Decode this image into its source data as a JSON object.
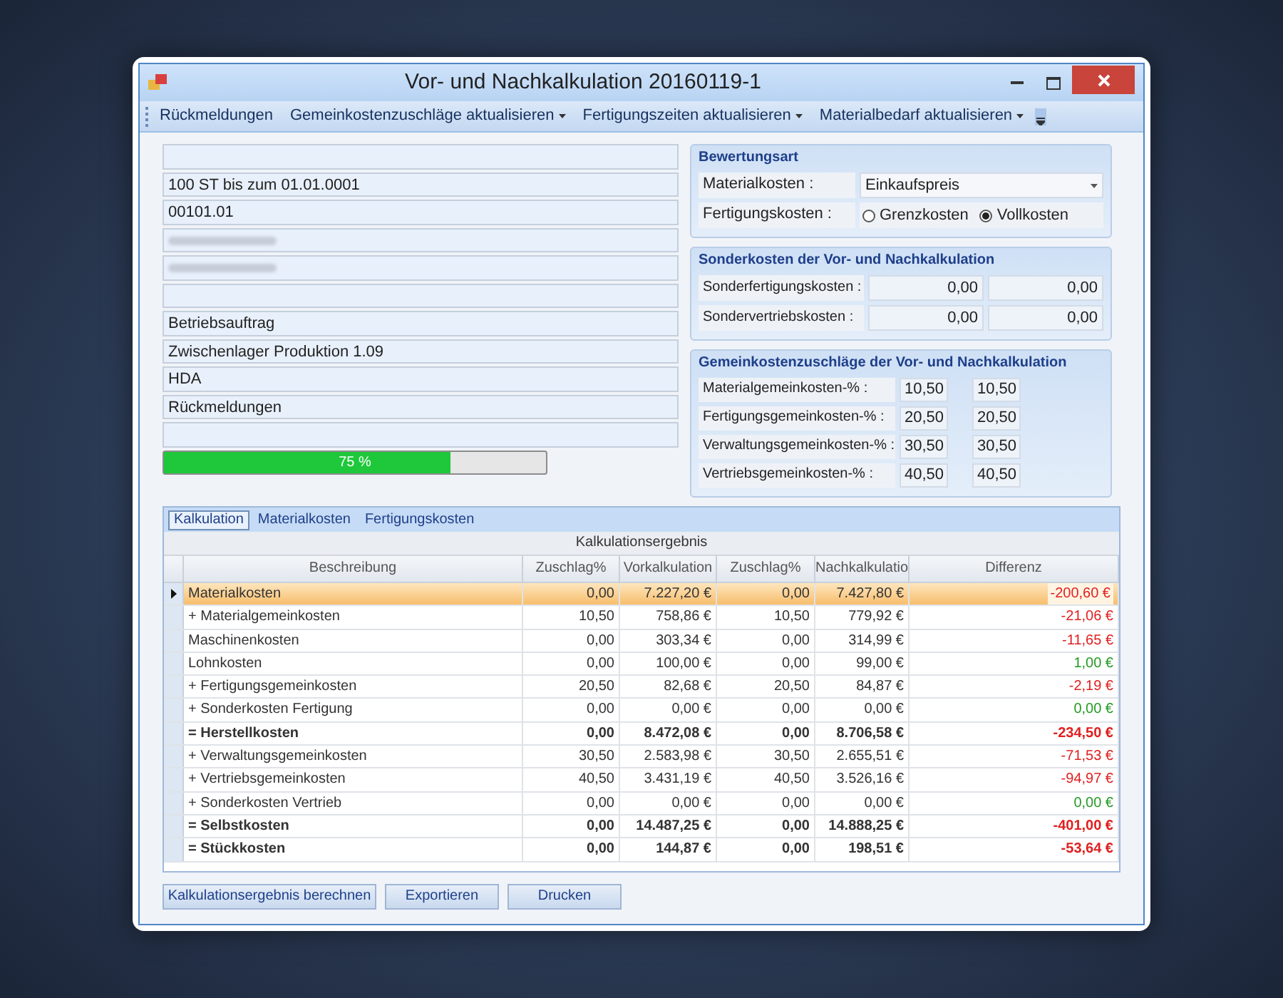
{
  "window": {
    "title": "Vor- und Nachkalkulation 20160119-1"
  },
  "toolbar": {
    "items": [
      {
        "label": "Rückmeldungen",
        "dropdown": false
      },
      {
        "label": "Gemeinkostenzuschläge aktualisieren",
        "dropdown": true
      },
      {
        "label": "Fertigungszeiten aktualisieren",
        "dropdown": true
      },
      {
        "label": "Materialbedarf aktualisieren",
        "dropdown": true
      }
    ]
  },
  "info_fields": [
    {
      "kind": "empty"
    },
    {
      "kind": "text",
      "value": "100 ST bis zum 01.01.0001"
    },
    {
      "kind": "text",
      "value": "00101.01"
    },
    {
      "kind": "blurred"
    },
    {
      "kind": "blurred"
    },
    {
      "kind": "empty"
    },
    {
      "kind": "text",
      "value": "Betriebsauftrag"
    },
    {
      "kind": "text",
      "value": "Zwischenlager Produktion 1.09"
    },
    {
      "kind": "text",
      "value": "HDA"
    },
    {
      "kind": "text",
      "value": "Rückmeldungen"
    },
    {
      "kind": "empty"
    }
  ],
  "progress": {
    "level": 0.75,
    "label": "75 %"
  },
  "bewertungsart": {
    "title": "Bewertungsart",
    "material_label": "Materialkosten :",
    "material_value": "Einkaufspreis",
    "fertigung_label": "Fertigungskosten :",
    "options": [
      {
        "label": "Grenzkosten",
        "selected": false
      },
      {
        "label": "Vollkosten",
        "selected": true
      }
    ]
  },
  "sonderkosten": {
    "title": "Sonderkosten der Vor- und Nachkalkulation",
    "rows": [
      {
        "label": "Sonderfertigungskosten :",
        "values": [
          "0,00",
          "0,00"
        ]
      },
      {
        "label": "Sondervertriebskosten :",
        "values": [
          "0,00",
          "0,00"
        ]
      }
    ]
  },
  "gemeinkosten": {
    "title": "Gemeinkostenzuschläge  der Vor- und Nachkalkulation",
    "rows": [
      {
        "label": "Materialgemeinkosten-% :",
        "values": [
          "10,50",
          "10,50"
        ]
      },
      {
        "label": "Fertigungsgemeinkosten-% :",
        "values": [
          "20,50",
          "20,50"
        ]
      },
      {
        "label": "Verwaltungsgemeinkosten-% :",
        "values": [
          "30,50",
          "30,50"
        ]
      },
      {
        "label": "Vertriebsgemeinkosten-% :",
        "values": [
          "40,50",
          "40,50"
        ]
      }
    ]
  },
  "tabs": [
    {
      "label": "Kalkulation",
      "selected": true
    },
    {
      "label": "Materialkosten",
      "selected": false
    },
    {
      "label": "Fertigungskosten",
      "selected": false
    }
  ],
  "table": {
    "caption": "Kalkulationsergebnis",
    "columns": [
      "Beschreibung",
      "Zuschlag%",
      "Vorkalkulation",
      "Zuschlag%",
      "Nachkalkulatio",
      "Differenz"
    ],
    "rows": [
      {
        "selected": true,
        "bold": false,
        "color": "#e02020",
        "cells": [
          "Materialkosten",
          "0,00",
          "7.227,20 €",
          "0,00",
          "7.427,80 €",
          "-200,60 €"
        ]
      },
      {
        "selected": false,
        "bold": false,
        "color": "#e02020",
        "cells": [
          "+ Materialgemeinkosten",
          "10,50",
          "758,86 €",
          "10,50",
          "779,92 €",
          "-21,06 €"
        ]
      },
      {
        "selected": false,
        "bold": false,
        "color": "#e02020",
        "cells": [
          "Maschinenkosten",
          "0,00",
          "303,34 €",
          "0,00",
          "314,99 €",
          "-11,65 €"
        ]
      },
      {
        "selected": false,
        "bold": false,
        "color": "#229922",
        "cells": [
          "Lohnkosten",
          "0,00",
          "100,00 €",
          "0,00",
          "99,00 €",
          "1,00 €"
        ]
      },
      {
        "selected": false,
        "bold": false,
        "color": "#e02020",
        "cells": [
          "+ Fertigungsgemeinkosten",
          "20,50",
          "82,68 €",
          "20,50",
          "84,87 €",
          "-2,19 €"
        ]
      },
      {
        "selected": false,
        "bold": false,
        "color": "#229922",
        "cells": [
          "+ Sonderkosten Fertigung",
          "0,00",
          "0,00 €",
          "0,00",
          "0,00 €",
          "0,00 €"
        ]
      },
      {
        "selected": false,
        "bold": true,
        "color": "#e02020",
        "cells": [
          "= Herstellkosten",
          "0,00",
          "8.472,08 €",
          "0,00",
          "8.706,58 €",
          "-234,50 €"
        ]
      },
      {
        "selected": false,
        "bold": false,
        "color": "#e02020",
        "cells": [
          "+ Verwaltungsgemeinkosten",
          "30,50",
          "2.583,98 €",
          "30,50",
          "2.655,51 €",
          "-71,53 €"
        ]
      },
      {
        "selected": false,
        "bold": false,
        "color": "#e02020",
        "cells": [
          "+ Vertriebsgemeinkosten",
          "40,50",
          "3.431,19 €",
          "40,50",
          "3.526,16 €",
          "-94,97 €"
        ]
      },
      {
        "selected": false,
        "bold": false,
        "color": "#229922",
        "cells": [
          "+ Sonderkosten Vertrieb",
          "0,00",
          "0,00 €",
          "0,00",
          "0,00 €",
          "0,00 €"
        ]
      },
      {
        "selected": false,
        "bold": true,
        "color": "#e02020",
        "cells": [
          "= Selbstkosten",
          "0,00",
          "14.487,25 €",
          "0,00",
          "14.888,25 €",
          "-401,00 €"
        ]
      },
      {
        "selected": false,
        "bold": true,
        "color": "#e02020",
        "cells": [
          "= Stückkosten",
          "0,00",
          "144,87 €",
          "0,00",
          "198,51 €",
          "-53,64 €"
        ]
      }
    ]
  },
  "buttons": [
    "Kalkulationsergebnis berechnen",
    "Exportieren",
    "Drucken"
  ]
}
